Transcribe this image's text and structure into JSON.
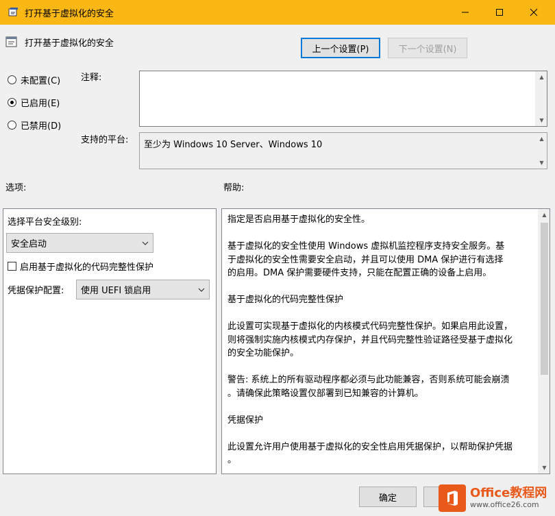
{
  "window": {
    "title": "打开基于虚拟化的安全",
    "minimize_icon": "minimize-icon",
    "maximize_icon": "maximize-icon",
    "close_icon": "close-icon"
  },
  "header": {
    "policy_name": "打开基于虚拟化的安全",
    "prev_button": "上一个设置(P)",
    "next_button": "下一个设置(N)"
  },
  "state": {
    "options": [
      {
        "label": "未配置(C)",
        "checked": false
      },
      {
        "label": "已启用(E)",
        "checked": true
      },
      {
        "label": "已禁用(D)",
        "checked": false
      }
    ]
  },
  "comment": {
    "label": "注释:",
    "value": ""
  },
  "supported": {
    "label": "支持的平台:",
    "value": "至少为 Windows 10 Server、Windows 10"
  },
  "options_panel": {
    "title": "选项:",
    "platform_level_label": "选择平台安全级别:",
    "platform_level_value": "安全启动",
    "code_integrity_label": "启用基于虚拟化的代码完整性保护",
    "code_integrity_checked": false,
    "credential_guard_label": "凭据保护配置:",
    "credential_guard_value": "使用 UEFI 锁启用"
  },
  "help_panel": {
    "title": "帮助:",
    "paragraphs": [
      "指定是否启用基于虚拟化的安全性。",
      "基于虚拟化的安全性使用 Windows 虚拟机监控程序支持安全服务。基\n于虚拟化的安全性需要安全启动，并且可以使用 DMA 保护进行有选择\n的启用。DMA 保护需要硬件支持，只能在配置正确的设备上启用。",
      "基于虚拟化的代码完整性保护",
      "此设置可实现基于虚拟化的内核模式代码完整性保护。如果启用此设置，\n则将强制实施内核模式内存保护，并且代码完整性验证路径受基于虚拟化\n的安全功能保护。",
      "警告: 系统上的所有驱动程序都必须与此功能兼容，否则系统可能会崩溃\n。请确保此策略设置仅部署到已知兼容的计算机。",
      "凭据保护",
      "此设置允许用户使用基于虚拟化的安全性启用凭据保护，以帮助保护凭据\n。"
    ]
  },
  "footer": {
    "ok_button": "确定",
    "cancel_button": ""
  },
  "watermark": {
    "title": "Office教程网",
    "url": "www.office26.com"
  },
  "colors": {
    "titlebar": "#fbb714",
    "accent": "#0078d7",
    "watermark": "#e8591a"
  }
}
